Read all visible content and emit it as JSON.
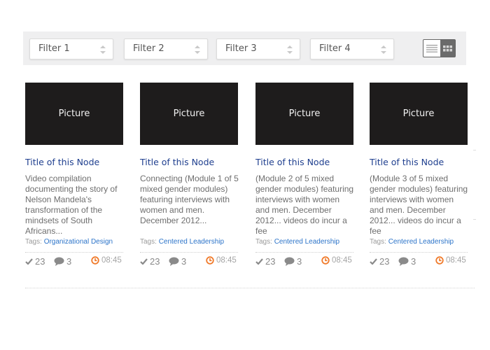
{
  "filters": [
    {
      "label": "Filter 1"
    },
    {
      "label": "Filter 2"
    },
    {
      "label": "Filter 3"
    },
    {
      "label": "Filter 4"
    }
  ],
  "view_toggle": {
    "list_icon": "list-view-icon",
    "grid_icon": "grid-view-icon",
    "active": "grid"
  },
  "cards": [
    {
      "picture_label": "Picture",
      "title": "Title of this Node",
      "description": "Video compilation documenting the story of Nelson Mandela's transformation of the mindsets of South Africans...",
      "tags_label": "Tags:",
      "tag": "Organizational Design",
      "likes": "23",
      "comments": "3",
      "time": "08:45"
    },
    {
      "picture_label": "Picture",
      "title": "Title of this Node",
      "description": "Connecting (Module 1 of 5 mixed gender modules) featuring interviews with women and men. December 2012...",
      "tags_label": "Tags:",
      "tag": "Centered Leadership",
      "likes": "23",
      "comments": "3",
      "time": "08:45"
    },
    {
      "picture_label": "Picture",
      "title": "Title of this Node",
      "description": "(Module 2 of 5 mixed gender modules) featuring interviews with women and men. December 2012... videos do incur a fee",
      "tags_label": "Tags:",
      "tag": "Centered Leadership",
      "likes": "23",
      "comments": "3",
      "time": "08:45"
    },
    {
      "picture_label": "Picture",
      "title": "Title of this Node",
      "description": "(Module 3 of 5 mixed gender modules) featuring interviews with women and men. December 2012... videos do incur a fee",
      "tags_label": "Tags:",
      "tag": "Centered Leadership",
      "likes": "23",
      "comments": "3",
      "time": "08:45"
    }
  ],
  "colors": {
    "title": "#1f3f8f",
    "tag_link": "#2c74c9",
    "clock": "#f07a2a",
    "picture_bg": "#1e1c1c"
  }
}
